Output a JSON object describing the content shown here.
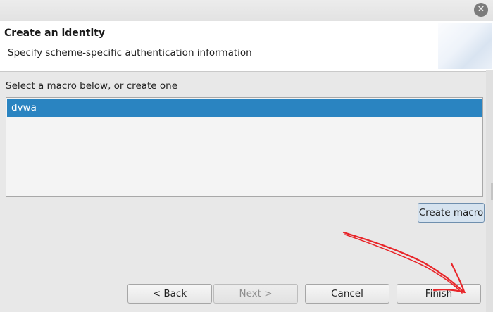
{
  "window": {
    "close_glyph": "✕"
  },
  "header": {
    "title": "Create an identity",
    "description": "Specify scheme-specific authentication information"
  },
  "macro_section": {
    "label": "Select a macro below, or create one",
    "items": [
      {
        "label": "dvwa",
        "selected": true
      }
    ],
    "selection_color": "#2a84c1",
    "create_button_label": "Create macro"
  },
  "footer": {
    "back_label": "< Back",
    "next_label": "Next >",
    "next_enabled": false,
    "cancel_label": "Cancel",
    "finish_label": "Finish"
  },
  "annotation": {
    "type": "hand-drawn arrow",
    "color": "#e8262a",
    "points_to": "finish-button"
  }
}
